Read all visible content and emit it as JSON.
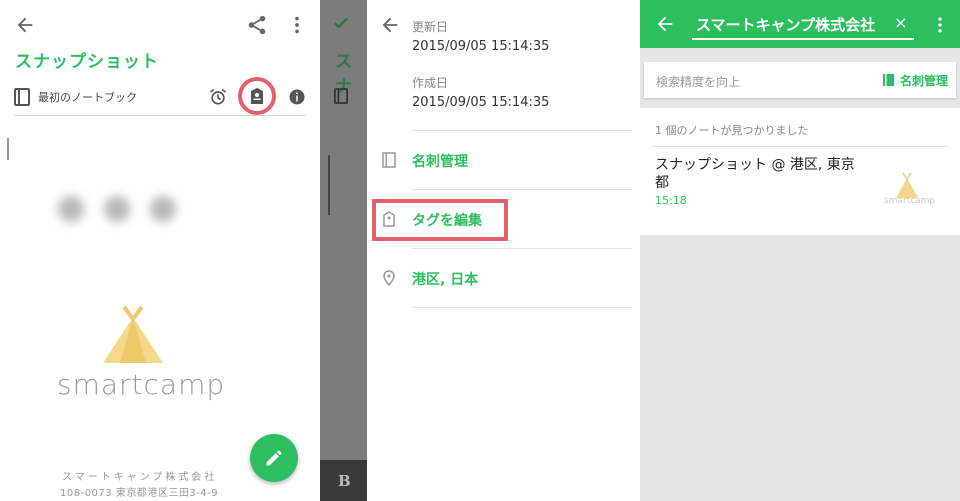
{
  "panel1": {
    "title": "スナップショット",
    "notebook_label": "最初のノートブック",
    "logo_text": "smartcamp",
    "address_line1": "スマートキャンプ株式会社",
    "address_line2": "108-0073 東京都港区三田3-4-9",
    "icons": [
      "back-arrow-icon",
      "share-icon",
      "more-vertical-icon",
      "notebook-icon",
      "alarm-icon",
      "business-card-icon",
      "info-icon",
      "pencil-icon"
    ],
    "colors": {
      "accent": "#2dbe60",
      "highlight": "#e4606a"
    }
  },
  "panel2": {
    "background_title": "スナ",
    "background_button": "B",
    "updated_label": "更新日",
    "updated_value": "2015/09/05 15:14:35",
    "created_label": "作成日",
    "created_value": "2015/09/05 15:14:35",
    "items": [
      {
        "label": "名刺管理",
        "icon": "business-card-icon"
      },
      {
        "label": "タグを編集",
        "icon": "tag-icon"
      },
      {
        "label": "港区, 日本",
        "icon": "location-pin-icon"
      }
    ]
  },
  "panel3": {
    "search_query": "スマートキャンプ株式会社",
    "clear_symbol": "×",
    "filter_placeholder": "検索精度を向上",
    "card_button_label": "名刺管理",
    "result_count": "1 個のノートが見つかりました",
    "note_title": "スナップショット @ 港区, 東京都",
    "note_time": "15:18",
    "thumb_text": "smartcamp"
  }
}
